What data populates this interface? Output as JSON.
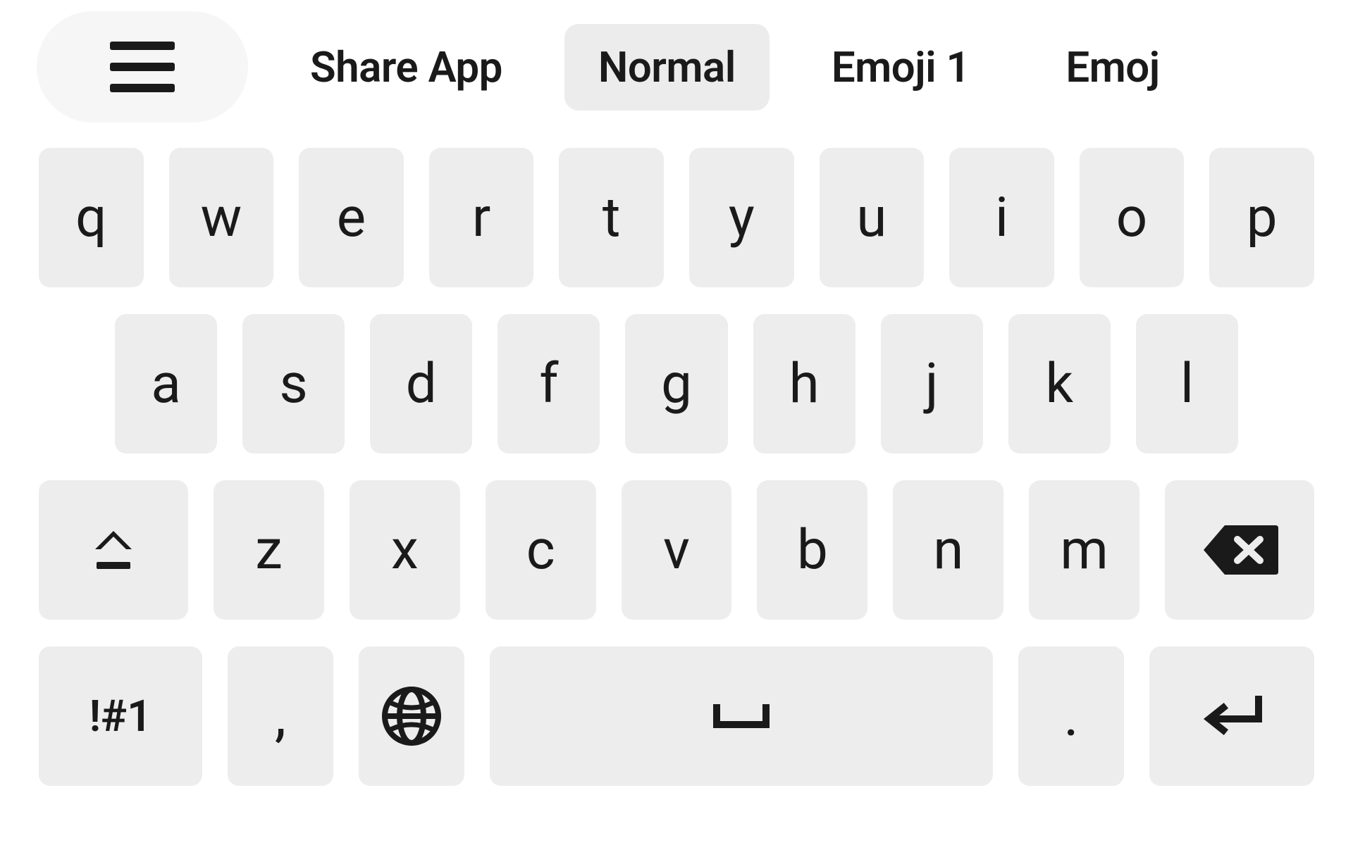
{
  "tabs": {
    "share": "Share App",
    "normal": "Normal",
    "emoji1": "Emoji 1",
    "emoji2": "Emoj"
  },
  "active_tab": "normal",
  "keyboard": {
    "row1": [
      "q",
      "w",
      "e",
      "r",
      "t",
      "y",
      "u",
      "i",
      "o",
      "p"
    ],
    "row2": [
      "a",
      "s",
      "d",
      "f",
      "g",
      "h",
      "j",
      "k",
      "l"
    ],
    "row3": [
      "z",
      "x",
      "c",
      "v",
      "b",
      "n",
      "m"
    ],
    "symbols_label": "!#1",
    "comma_label": ",",
    "period_label": "."
  }
}
